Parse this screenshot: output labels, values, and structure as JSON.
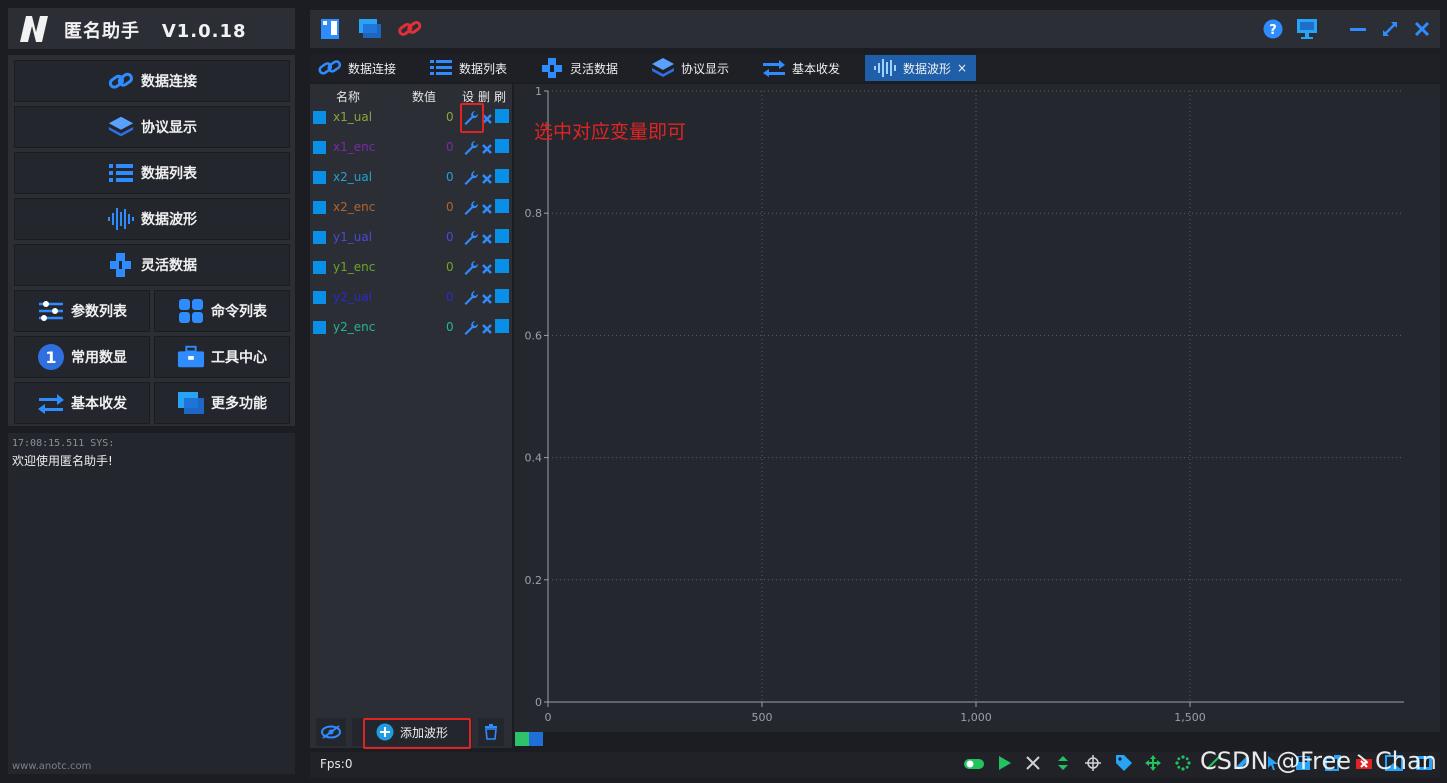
{
  "app": {
    "title": "匿名助手",
    "version": "V1.0.18"
  },
  "nav": [
    {
      "label": "数据连接",
      "icon": "link-icon"
    },
    {
      "label": "协议显示",
      "icon": "layers-icon"
    },
    {
      "label": "数据列表",
      "icon": "list-icon"
    },
    {
      "label": "数据波形",
      "icon": "waveform-icon"
    },
    {
      "label": "灵活数据",
      "icon": "cubes-icon"
    },
    {
      "label": "参数列表",
      "icon": "sliders-icon"
    },
    {
      "label": "命令列表",
      "icon": "grid-icon"
    },
    {
      "label": "常用数显",
      "icon": "number-one-icon"
    },
    {
      "label": "工具中心",
      "icon": "toolbox-icon"
    },
    {
      "label": "基本收发",
      "icon": "transfer-arrows-icon"
    },
    {
      "label": "更多功能",
      "icon": "windows-icon"
    }
  ],
  "log": {
    "timestamp": "17:08:15.511 SYS:",
    "message": "欢迎使用匿名助手!"
  },
  "footer_site": "www.anotc.com",
  "tabs": [
    {
      "label": "数据连接",
      "icon": "link-icon"
    },
    {
      "label": "数据列表",
      "icon": "list-icon"
    },
    {
      "label": "灵活数据",
      "icon": "cubes-icon"
    },
    {
      "label": "协议显示",
      "icon": "layers-icon"
    },
    {
      "label": "基本收发",
      "icon": "transfer-arrows-icon"
    },
    {
      "label": "数据波形",
      "icon": "waveform-icon",
      "active": true,
      "close": "×"
    }
  ],
  "var_table": {
    "headers": {
      "name": "名称",
      "value": "数值",
      "set": "设",
      "delete": "删",
      "refresh": "刷"
    },
    "rows": [
      {
        "name": "x1_ual",
        "value": "0",
        "color": "#8fa33a"
      },
      {
        "name": "x1_enc",
        "value": "0",
        "color": "#7a2aa8"
      },
      {
        "name": "x2_ual",
        "value": "0",
        "color": "#1fa3d6"
      },
      {
        "name": "x2_enc",
        "value": "0",
        "color": "#b5652a"
      },
      {
        "name": "y1_ual",
        "value": "0",
        "color": "#4a4ad6"
      },
      {
        "name": "y1_enc",
        "value": "0",
        "color": "#6ea52a"
      },
      {
        "name": "y2_ual",
        "value": "0",
        "color": "#2a2ad0"
      },
      {
        "name": "y2_enc",
        "value": "0",
        "color": "#22b890"
      }
    ],
    "add_button": "添加波形"
  },
  "annotation": "选中对应变量即可",
  "status": {
    "fps": "Fps:0",
    "watermark": "CSDN @Free丶Chan"
  },
  "colors": {
    "accent": "#1f5ea8",
    "checkbox": "#0a8fe6",
    "annotation": "#e02424"
  },
  "chart_data": {
    "type": "line",
    "series": [],
    "xlim": [
      0,
      2000
    ],
    "ylim": [
      0,
      1
    ],
    "xticks": [
      "0",
      "500",
      "1,000",
      "1,500"
    ],
    "yticks": [
      "0",
      "0.2",
      "0.4",
      "0.6",
      "0.8",
      "1"
    ],
    "grid": true
  }
}
